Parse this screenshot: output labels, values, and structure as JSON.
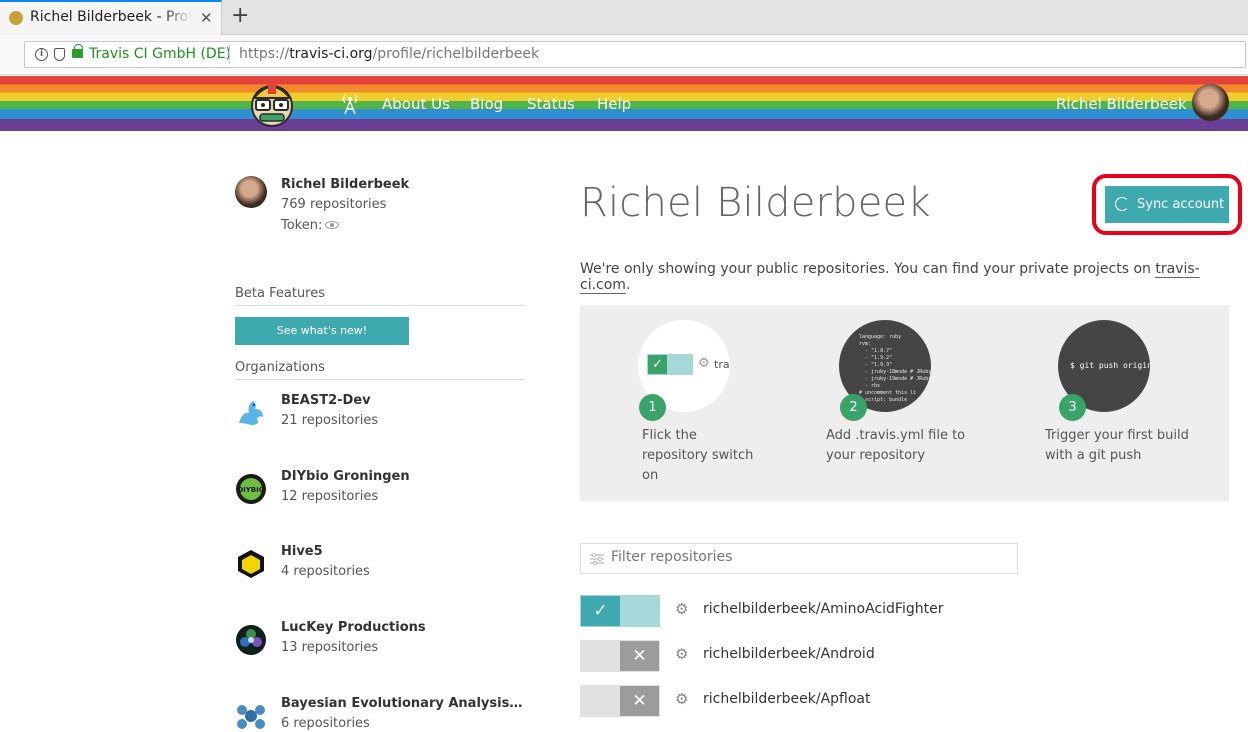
{
  "browser": {
    "tab_title": "Richel Bilderbeek - Profile",
    "tab_close": "✕",
    "new_tab": "+",
    "url_org": "Travis CI GmbH (DE)",
    "url_prefix": "https://",
    "url_domain": "travis-ci.org",
    "url_path": "/profile/richelbilderbeek"
  },
  "header": {
    "nav": [
      "About Us",
      "Blog",
      "Status",
      "Help"
    ],
    "user_name": "Richel Bilderbeek"
  },
  "sidebar": {
    "name": "Richel Bilderbeek",
    "repos": "769 repositories",
    "token_label": "Token:",
    "beta_title": "Beta Features",
    "beta_button": "See what's new!",
    "orgs_title": "Organizations",
    "orgs": [
      {
        "name": "BEAST2-Dev",
        "repos": "21 repositories"
      },
      {
        "name": "DIYbio Groningen",
        "repos": "12 repositories"
      },
      {
        "name": "Hive5",
        "repos": "4 repositories"
      },
      {
        "name": "LucKey Productions",
        "repos": "13 repositories"
      },
      {
        "name": "Bayesian Evolutionary Analysis Samp…",
        "repos": "6 repositories"
      }
    ]
  },
  "main": {
    "title": "Richel Bilderbeek",
    "sync_button": "Sync account",
    "notice_text": "We're only showing your public repositories. You can find your private projects on ",
    "notice_link": "travis-ci.com",
    "notice_end": ".",
    "steps": [
      {
        "num": "1",
        "text": [
          "Flick the",
          "repository switch",
          "on"
        ],
        "visual": "tra"
      },
      {
        "num": "2",
        "text": [
          "Add .travis.yml file to",
          "your repository"
        ],
        "code": "language: ruby\nrvm:\n  - \"1.8.7\"\n  - \"1.9.2\"\n  - \"1.9.3\"\n  - jruby-18mode # JRuby\n  - jruby-19mode # JRuby\n  - rbx\n# uncomment this li\n# script: bundle"
      },
      {
        "num": "3",
        "text": [
          "Trigger your first build",
          "with a git push"
        ],
        "code": "$ git push origin"
      }
    ],
    "filter_placeholder": "Filter repositories",
    "repos": [
      {
        "name": "richelbilderbeek/AminoAcidFighter",
        "active": true
      },
      {
        "name": "richelbilderbeek/Android",
        "active": false
      },
      {
        "name": "richelbilderbeek/Apfloat",
        "active": false
      }
    ]
  },
  "icons": {
    "gear": "⚙",
    "check": "✓",
    "cross": "✕"
  },
  "colors": {
    "accent": "#3eaaaf",
    "step_green": "#3aa368",
    "highlight": "#e8001c"
  }
}
